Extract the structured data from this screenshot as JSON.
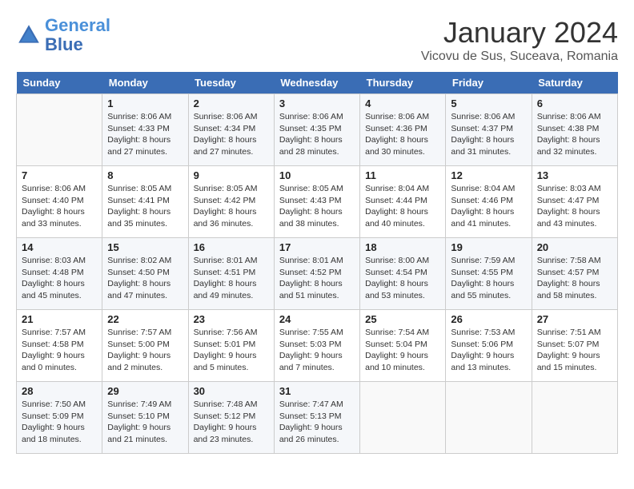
{
  "header": {
    "logo_line1": "General",
    "logo_line2": "Blue",
    "month_year": "January 2024",
    "location": "Vicovu de Sus, Suceava, Romania"
  },
  "weekdays": [
    "Sunday",
    "Monday",
    "Tuesday",
    "Wednesday",
    "Thursday",
    "Friday",
    "Saturday"
  ],
  "weeks": [
    [
      {
        "day": "",
        "sunrise": "",
        "sunset": "",
        "daylight": ""
      },
      {
        "day": "1",
        "sunrise": "Sunrise: 8:06 AM",
        "sunset": "Sunset: 4:33 PM",
        "daylight": "Daylight: 8 hours and 27 minutes."
      },
      {
        "day": "2",
        "sunrise": "Sunrise: 8:06 AM",
        "sunset": "Sunset: 4:34 PM",
        "daylight": "Daylight: 8 hours and 27 minutes."
      },
      {
        "day": "3",
        "sunrise": "Sunrise: 8:06 AM",
        "sunset": "Sunset: 4:35 PM",
        "daylight": "Daylight: 8 hours and 28 minutes."
      },
      {
        "day": "4",
        "sunrise": "Sunrise: 8:06 AM",
        "sunset": "Sunset: 4:36 PM",
        "daylight": "Daylight: 8 hours and 30 minutes."
      },
      {
        "day": "5",
        "sunrise": "Sunrise: 8:06 AM",
        "sunset": "Sunset: 4:37 PM",
        "daylight": "Daylight: 8 hours and 31 minutes."
      },
      {
        "day": "6",
        "sunrise": "Sunrise: 8:06 AM",
        "sunset": "Sunset: 4:38 PM",
        "daylight": "Daylight: 8 hours and 32 minutes."
      }
    ],
    [
      {
        "day": "7",
        "sunrise": "Sunrise: 8:06 AM",
        "sunset": "Sunset: 4:40 PM",
        "daylight": "Daylight: 8 hours and 33 minutes."
      },
      {
        "day": "8",
        "sunrise": "Sunrise: 8:05 AM",
        "sunset": "Sunset: 4:41 PM",
        "daylight": "Daylight: 8 hours and 35 minutes."
      },
      {
        "day": "9",
        "sunrise": "Sunrise: 8:05 AM",
        "sunset": "Sunset: 4:42 PM",
        "daylight": "Daylight: 8 hours and 36 minutes."
      },
      {
        "day": "10",
        "sunrise": "Sunrise: 8:05 AM",
        "sunset": "Sunset: 4:43 PM",
        "daylight": "Daylight: 8 hours and 38 minutes."
      },
      {
        "day": "11",
        "sunrise": "Sunrise: 8:04 AM",
        "sunset": "Sunset: 4:44 PM",
        "daylight": "Daylight: 8 hours and 40 minutes."
      },
      {
        "day": "12",
        "sunrise": "Sunrise: 8:04 AM",
        "sunset": "Sunset: 4:46 PM",
        "daylight": "Daylight: 8 hours and 41 minutes."
      },
      {
        "day": "13",
        "sunrise": "Sunrise: 8:03 AM",
        "sunset": "Sunset: 4:47 PM",
        "daylight": "Daylight: 8 hours and 43 minutes."
      }
    ],
    [
      {
        "day": "14",
        "sunrise": "Sunrise: 8:03 AM",
        "sunset": "Sunset: 4:48 PM",
        "daylight": "Daylight: 8 hours and 45 minutes."
      },
      {
        "day": "15",
        "sunrise": "Sunrise: 8:02 AM",
        "sunset": "Sunset: 4:50 PM",
        "daylight": "Daylight: 8 hours and 47 minutes."
      },
      {
        "day": "16",
        "sunrise": "Sunrise: 8:01 AM",
        "sunset": "Sunset: 4:51 PM",
        "daylight": "Daylight: 8 hours and 49 minutes."
      },
      {
        "day": "17",
        "sunrise": "Sunrise: 8:01 AM",
        "sunset": "Sunset: 4:52 PM",
        "daylight": "Daylight: 8 hours and 51 minutes."
      },
      {
        "day": "18",
        "sunrise": "Sunrise: 8:00 AM",
        "sunset": "Sunset: 4:54 PM",
        "daylight": "Daylight: 8 hours and 53 minutes."
      },
      {
        "day": "19",
        "sunrise": "Sunrise: 7:59 AM",
        "sunset": "Sunset: 4:55 PM",
        "daylight": "Daylight: 8 hours and 55 minutes."
      },
      {
        "day": "20",
        "sunrise": "Sunrise: 7:58 AM",
        "sunset": "Sunset: 4:57 PM",
        "daylight": "Daylight: 8 hours and 58 minutes."
      }
    ],
    [
      {
        "day": "21",
        "sunrise": "Sunrise: 7:57 AM",
        "sunset": "Sunset: 4:58 PM",
        "daylight": "Daylight: 9 hours and 0 minutes."
      },
      {
        "day": "22",
        "sunrise": "Sunrise: 7:57 AM",
        "sunset": "Sunset: 5:00 PM",
        "daylight": "Daylight: 9 hours and 2 minutes."
      },
      {
        "day": "23",
        "sunrise": "Sunrise: 7:56 AM",
        "sunset": "Sunset: 5:01 PM",
        "daylight": "Daylight: 9 hours and 5 minutes."
      },
      {
        "day": "24",
        "sunrise": "Sunrise: 7:55 AM",
        "sunset": "Sunset: 5:03 PM",
        "daylight": "Daylight: 9 hours and 7 minutes."
      },
      {
        "day": "25",
        "sunrise": "Sunrise: 7:54 AM",
        "sunset": "Sunset: 5:04 PM",
        "daylight": "Daylight: 9 hours and 10 minutes."
      },
      {
        "day": "26",
        "sunrise": "Sunrise: 7:53 AM",
        "sunset": "Sunset: 5:06 PM",
        "daylight": "Daylight: 9 hours and 13 minutes."
      },
      {
        "day": "27",
        "sunrise": "Sunrise: 7:51 AM",
        "sunset": "Sunset: 5:07 PM",
        "daylight": "Daylight: 9 hours and 15 minutes."
      }
    ],
    [
      {
        "day": "28",
        "sunrise": "Sunrise: 7:50 AM",
        "sunset": "Sunset: 5:09 PM",
        "daylight": "Daylight: 9 hours and 18 minutes."
      },
      {
        "day": "29",
        "sunrise": "Sunrise: 7:49 AM",
        "sunset": "Sunset: 5:10 PM",
        "daylight": "Daylight: 9 hours and 21 minutes."
      },
      {
        "day": "30",
        "sunrise": "Sunrise: 7:48 AM",
        "sunset": "Sunset: 5:12 PM",
        "daylight": "Daylight: 9 hours and 23 minutes."
      },
      {
        "day": "31",
        "sunrise": "Sunrise: 7:47 AM",
        "sunset": "Sunset: 5:13 PM",
        "daylight": "Daylight: 9 hours and 26 minutes."
      },
      {
        "day": "",
        "sunrise": "",
        "sunset": "",
        "daylight": ""
      },
      {
        "day": "",
        "sunrise": "",
        "sunset": "",
        "daylight": ""
      },
      {
        "day": "",
        "sunrise": "",
        "sunset": "",
        "daylight": ""
      }
    ]
  ]
}
